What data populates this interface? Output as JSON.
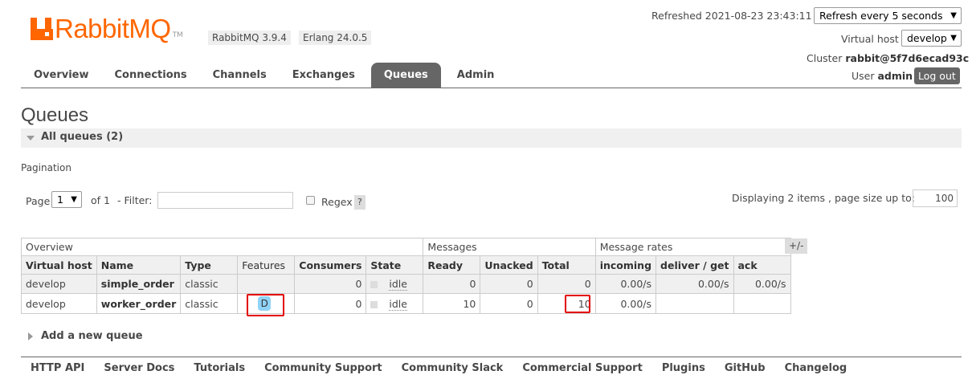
{
  "brand": {
    "logo_text": "RabbitMQ",
    "tm": "TM",
    "version_badge": "RabbitMQ 3.9.4",
    "erlang_badge": "Erlang 24.0.5",
    "accent_color": "#ff6600"
  },
  "header": {
    "refreshed": "Refreshed 2021-08-23 23:43:11",
    "refresh_select": "Refresh every 5 seconds",
    "virtual_host_label": "Virtual host",
    "virtual_host_value": "develop",
    "cluster_label": "Cluster",
    "cluster_value": "rabbit@5f7d6ecad93c",
    "user_label": "User",
    "user_value": "admin",
    "logout": "Log out"
  },
  "tabs": [
    {
      "label": "Overview",
      "active": false
    },
    {
      "label": "Connections",
      "active": false
    },
    {
      "label": "Channels",
      "active": false
    },
    {
      "label": "Exchanges",
      "active": false
    },
    {
      "label": "Queues",
      "active": true
    },
    {
      "label": "Admin",
      "active": false
    }
  ],
  "page": {
    "title": "Queues",
    "section": "All queues (2)",
    "pagination_label": "Pagination",
    "page_label": "Page",
    "page_value": "1",
    "of_label": "of 1",
    "filter_label": "- Filter:",
    "filter_value": "",
    "regex_label": "Regex",
    "help": "?",
    "displaying": "Displaying 2 items , page size up to:",
    "page_size": "100"
  },
  "table": {
    "groups": [
      "Overview",
      "Messages",
      "Message rates"
    ],
    "plus_minus": "+/-",
    "columns": [
      "Virtual host",
      "Name",
      "Type",
      "Features",
      "Consumers",
      "State",
      "Ready",
      "Unacked",
      "Total",
      "incoming",
      "deliver / get",
      "ack"
    ],
    "rows": [
      {
        "vhost": "develop",
        "name": "simple_order",
        "type": "classic",
        "features": "",
        "consumers": "0",
        "state": "idle",
        "ready": "0",
        "unacked": "0",
        "total": "0",
        "incoming": "0.00/s",
        "deliver_get": "0.00/s",
        "ack": "0.00/s"
      },
      {
        "vhost": "develop",
        "name": "worker_order",
        "type": "classic",
        "features": "D",
        "consumers": "0",
        "state": "idle",
        "ready": "10",
        "unacked": "0",
        "total": "10",
        "incoming": "0.00/s",
        "deliver_get": "",
        "ack": ""
      }
    ]
  },
  "add_queue": "Add a new queue",
  "footer": [
    "HTTP API",
    "Server Docs",
    "Tutorials",
    "Community Support",
    "Community Slack",
    "Commercial Support",
    "Plugins",
    "GitHub",
    "Changelog"
  ]
}
